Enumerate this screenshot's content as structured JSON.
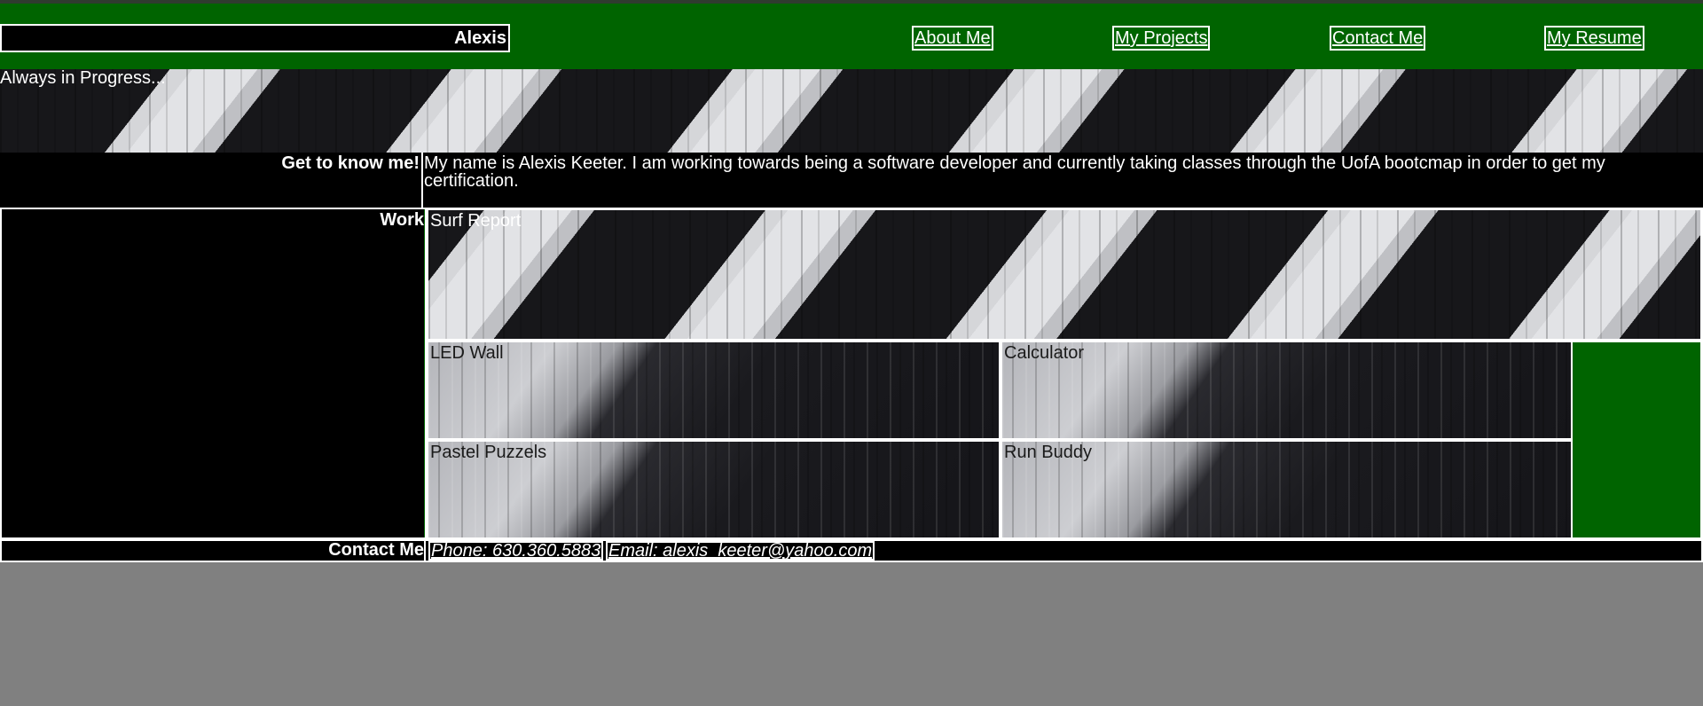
{
  "header": {
    "brand": "Alexis",
    "nav": [
      "About Me",
      "My Projects",
      "Contact Me",
      "My Resume"
    ]
  },
  "hero": {
    "tagline": "Always in Progress..."
  },
  "about": {
    "label": "Get to know me!",
    "text": "My name is Alexis Keeter. I am working towards being a software developer and currently taking classes through the UofA bootcmap in order to get my certification."
  },
  "work": {
    "label": "Work",
    "projects": [
      "Surf Report",
      "LED Wall",
      "Calculator",
      "Pastel Puzzels",
      "Run Buddy"
    ]
  },
  "contact": {
    "label": "Contact Me",
    "phone": "Phone: 630.360.5883",
    "email": "Email: alexis_keeter@yahoo.com"
  },
  "colors": {
    "header_green": "#006400",
    "page_gray": "#808080",
    "panel_black": "#000000"
  }
}
